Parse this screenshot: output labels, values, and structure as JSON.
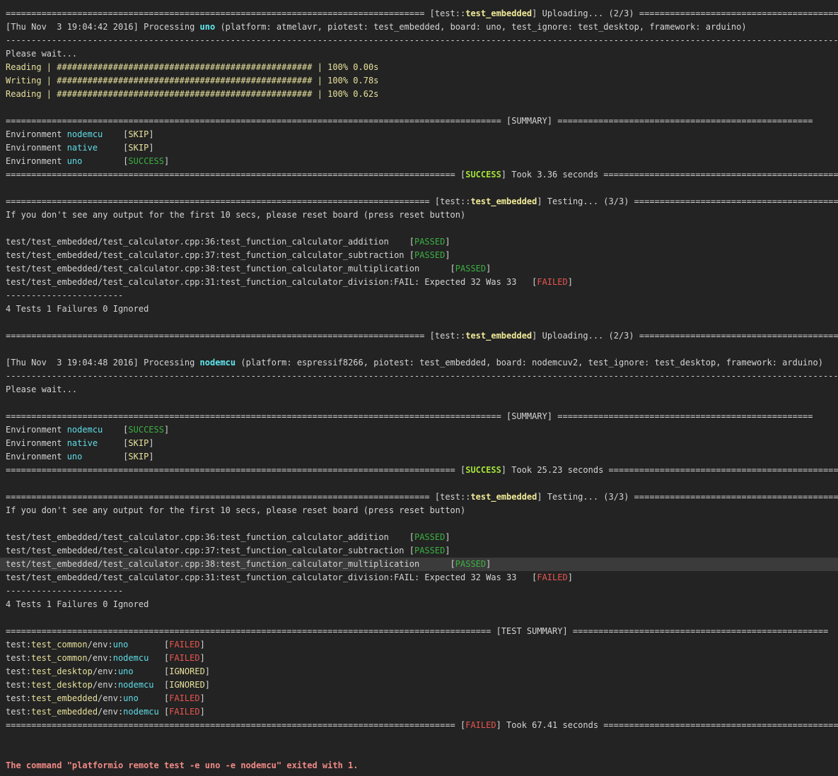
{
  "colors": {
    "background": "#232323",
    "text": "#d4d4d4",
    "yellow": "#e6e09c",
    "cyan": "#5fdde6",
    "green": "#3cb043",
    "success": "#a4e23a",
    "red": "#e8554e",
    "error": "#f08a86"
  },
  "highlighted_line": 41,
  "lines": [
    [
      [
        "==================================================================================",
        ""
      ],
      [
        " [test::",
        ""
      ],
      [
        "test_embedded",
        "yb"
      ],
      [
        "] Uploading... (2/3) ==================================================",
        ""
      ]
    ],
    [
      [
        "[Thu Nov  3 19:04:42 2016] Processing ",
        ""
      ],
      [
        "uno",
        "cb"
      ],
      [
        " (platform: atmelavr, piotest: test_embedded, board: uno, test_ignore: test_desktop, framework: arduino)",
        ""
      ]
    ],
    [
      [
        "--------------------------------------------------------------------------------------------------------------------------------------------------------------------------",
        ""
      ]
    ],
    [
      [
        "Please wait...",
        ""
      ]
    ],
    [
      [
        "Reading | ################################################## | 100% 0.00s",
        "y"
      ]
    ],
    [
      [
        "Writing | ################################################## | 100% 0.78s",
        "y"
      ]
    ],
    [
      [
        "Reading | ################################################## | 100% 0.62s",
        "y"
      ]
    ],
    [],
    [
      [
        "================================================================================================= [SUMMARY] ==================================================",
        ""
      ]
    ],
    [
      [
        "Environment ",
        ""
      ],
      [
        "nodemcu",
        "c"
      ],
      [
        "    [",
        ""
      ],
      [
        "SKIP",
        "y"
      ],
      [
        "]",
        ""
      ]
    ],
    [
      [
        "Environment ",
        ""
      ],
      [
        "native",
        "c"
      ],
      [
        "     [",
        ""
      ],
      [
        "SKIP",
        "y"
      ],
      [
        "]",
        ""
      ]
    ],
    [
      [
        "Environment ",
        ""
      ],
      [
        "uno",
        "c"
      ],
      [
        "        [",
        ""
      ],
      [
        "SUCCESS",
        "g"
      ],
      [
        "]",
        ""
      ]
    ],
    [
      [
        "======================================================================================== [",
        ""
      ],
      [
        "SUCCESS",
        "gb"
      ],
      [
        "] Took 3.36 seconds ==================================================",
        ""
      ]
    ],
    [],
    [
      [
        "=================================================================================== [test::",
        ""
      ],
      [
        "test_embedded",
        "yb"
      ],
      [
        "] Testing... (3/3) ==================================================",
        ""
      ]
    ],
    [
      [
        "If you don't see any output for the first 10 secs, please reset board (press reset button)",
        ""
      ]
    ],
    [],
    [
      [
        "test/test_embedded/test_calculator.cpp:36:test_function_calculator_addition    [",
        ""
      ],
      [
        "PASSED",
        "g"
      ],
      [
        "]",
        ""
      ]
    ],
    [
      [
        "test/test_embedded/test_calculator.cpp:37:test_function_calculator_subtraction [",
        ""
      ],
      [
        "PASSED",
        "g"
      ],
      [
        "]",
        ""
      ]
    ],
    [
      [
        "test/test_embedded/test_calculator.cpp:38:test_function_calculator_multiplication      [",
        ""
      ],
      [
        "PASSED",
        "g"
      ],
      [
        "]",
        ""
      ]
    ],
    [
      [
        "test/test_embedded/test_calculator.cpp:31:test_function_calculator_division:FAIL: Expected 32 Was 33   [",
        ""
      ],
      [
        "FAILED",
        "r"
      ],
      [
        "]",
        ""
      ]
    ],
    [
      [
        "-----------------------",
        ""
      ]
    ],
    [
      [
        "4 Tests 1 Failures 0 Ignored",
        ""
      ]
    ],
    [],
    [
      [
        "================================================================================== [test::",
        ""
      ],
      [
        "test_embedded",
        "yb"
      ],
      [
        "] Uploading... (2/3) ==================================================",
        ""
      ]
    ],
    [],
    [
      [
        "[Thu Nov  3 19:04:48 2016] Processing ",
        ""
      ],
      [
        "nodemcu",
        "cb"
      ],
      [
        " (platform: espressif8266, piotest: test_embedded, board: nodemcuv2, test_ignore: test_desktop, framework: arduino)",
        ""
      ]
    ],
    [
      [
        "--------------------------------------------------------------------------------------------------------------------------------------------------------------------------",
        ""
      ]
    ],
    [
      [
        "Please wait...",
        ""
      ]
    ],
    [],
    [
      [
        "================================================================================================= [SUMMARY] ==================================================",
        ""
      ]
    ],
    [
      [
        "Environment ",
        ""
      ],
      [
        "nodemcu",
        "c"
      ],
      [
        "    [",
        ""
      ],
      [
        "SUCCESS",
        "g"
      ],
      [
        "]",
        ""
      ]
    ],
    [
      [
        "Environment ",
        ""
      ],
      [
        "native",
        "c"
      ],
      [
        "     [",
        ""
      ],
      [
        "SKIP",
        "y"
      ],
      [
        "]",
        ""
      ]
    ],
    [
      [
        "Environment ",
        ""
      ],
      [
        "uno",
        "c"
      ],
      [
        "        [",
        ""
      ],
      [
        "SKIP",
        "y"
      ],
      [
        "]",
        ""
      ]
    ],
    [
      [
        "======================================================================================== [",
        ""
      ],
      [
        "SUCCESS",
        "gb"
      ],
      [
        "] Took 25.23 seconds ==================================================",
        ""
      ]
    ],
    [],
    [
      [
        "=================================================================================== [test::",
        ""
      ],
      [
        "test_embedded",
        "yb"
      ],
      [
        "] Testing... (3/3) ==================================================",
        ""
      ]
    ],
    [
      [
        "If you don't see any output for the first 10 secs, please reset board (press reset button)",
        ""
      ]
    ],
    [],
    [
      [
        "test/test_embedded/test_calculator.cpp:36:test_function_calculator_addition    [",
        ""
      ],
      [
        "PASSED",
        "g"
      ],
      [
        "]",
        ""
      ]
    ],
    [
      [
        "test/test_embedded/test_calculator.cpp:37:test_function_calculator_subtraction [",
        ""
      ],
      [
        "PASSED",
        "g"
      ],
      [
        "]",
        ""
      ]
    ],
    [
      [
        "test/test_embedded/test_calculator.cpp:38:test_function_calculator_multiplication      [",
        ""
      ],
      [
        "PASSED",
        "g"
      ],
      [
        "]",
        ""
      ]
    ],
    [
      [
        "test/test_embedded/test_calculator.cpp:31:test_function_calculator_division:FAIL: Expected 32 Was 33   [",
        ""
      ],
      [
        "FAILED",
        "r"
      ],
      [
        "]",
        ""
      ]
    ],
    [
      [
        "-----------------------",
        ""
      ]
    ],
    [
      [
        "4 Tests 1 Failures 0 Ignored",
        ""
      ]
    ],
    [],
    [
      [
        "=============================================================================================== [TEST SUMMARY] ==================================================",
        ""
      ]
    ],
    [
      [
        "test:",
        ""
      ],
      [
        "test_common",
        "y"
      ],
      [
        "/env:",
        ""
      ],
      [
        "uno",
        "c"
      ],
      [
        "       [",
        ""
      ],
      [
        "FAILED",
        "r"
      ],
      [
        "]",
        ""
      ]
    ],
    [
      [
        "test:",
        ""
      ],
      [
        "test_common",
        "y"
      ],
      [
        "/env:",
        ""
      ],
      [
        "nodemcu",
        "c"
      ],
      [
        "   [",
        ""
      ],
      [
        "FAILED",
        "r"
      ],
      [
        "]",
        ""
      ]
    ],
    [
      [
        "test:",
        ""
      ],
      [
        "test_desktop",
        "y"
      ],
      [
        "/env:",
        ""
      ],
      [
        "uno",
        "c"
      ],
      [
        "      [",
        ""
      ],
      [
        "IGNORED",
        "y"
      ],
      [
        "]",
        ""
      ]
    ],
    [
      [
        "test:",
        ""
      ],
      [
        "test_desktop",
        "y"
      ],
      [
        "/env:",
        ""
      ],
      [
        "nodemcu",
        "c"
      ],
      [
        "  [",
        ""
      ],
      [
        "IGNORED",
        "y"
      ],
      [
        "]",
        ""
      ]
    ],
    [
      [
        "test:",
        ""
      ],
      [
        "test_embedded",
        "y"
      ],
      [
        "/env:",
        ""
      ],
      [
        "uno",
        "c"
      ],
      [
        "     [",
        ""
      ],
      [
        "FAILED",
        "r"
      ],
      [
        "]",
        ""
      ]
    ],
    [
      [
        "test:",
        ""
      ],
      [
        "test_embedded",
        "y"
      ],
      [
        "/env:",
        ""
      ],
      [
        "nodemcu",
        "c"
      ],
      [
        " [",
        ""
      ],
      [
        "FAILED",
        "r"
      ],
      [
        "]",
        ""
      ]
    ],
    [
      [
        "======================================================================================== [",
        ""
      ],
      [
        "FAILED",
        "r"
      ],
      [
        "] Took 67.41 seconds ==================================================",
        ""
      ]
    ],
    [],
    [],
    [
      [
        "The command \"platformio remote test -e uno -e nodemcu\" exited with 1.",
        "rb"
      ]
    ]
  ]
}
